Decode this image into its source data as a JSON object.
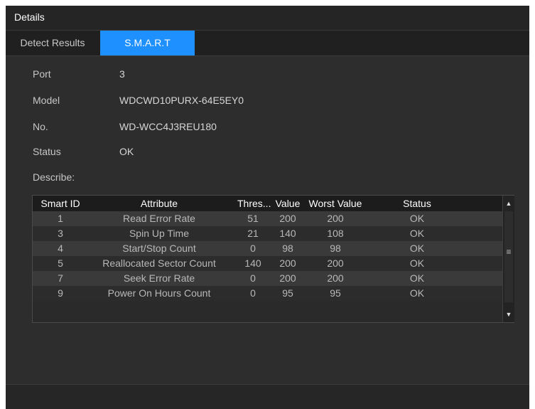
{
  "window": {
    "title": "Details"
  },
  "tabs": [
    {
      "label": "Detect Results",
      "active": false
    },
    {
      "label": "S.M.A.R.T",
      "active": true
    }
  ],
  "info": {
    "port_label": "Port",
    "port_value": "3",
    "model_label": "Model",
    "model_value": "WDCWD10PURX-64E5EY0",
    "no_label": "No.",
    "no_value": "WD-WCC4J3REU180",
    "status_label": "Status",
    "status_value": "OK",
    "describe_label": "Describe:"
  },
  "table": {
    "headers": [
      "Smart ID",
      "Attribute",
      "Thres...",
      "Value",
      "Worst Value",
      "Status"
    ],
    "rows": [
      [
        "1",
        "Read Error Rate",
        "51",
        "200",
        "200",
        "OK"
      ],
      [
        "3",
        "Spin Up Time",
        "21",
        "140",
        "108",
        "OK"
      ],
      [
        "4",
        "Start/Stop Count",
        "0",
        "98",
        "98",
        "OK"
      ],
      [
        "5",
        "Reallocated Sector Count",
        "140",
        "200",
        "200",
        "OK"
      ],
      [
        "7",
        "Seek Error Rate",
        "0",
        "200",
        "200",
        "OK"
      ],
      [
        "9",
        "Power On Hours Count",
        "0",
        "95",
        "95",
        "OK"
      ]
    ]
  },
  "icons": {
    "scroll_up": "scroll-up-arrow",
    "scroll_down": "scroll-down-arrow",
    "grip": "scroll-grip"
  },
  "colors": {
    "accent": "#1e90ff",
    "background": "#2d2d2d"
  }
}
